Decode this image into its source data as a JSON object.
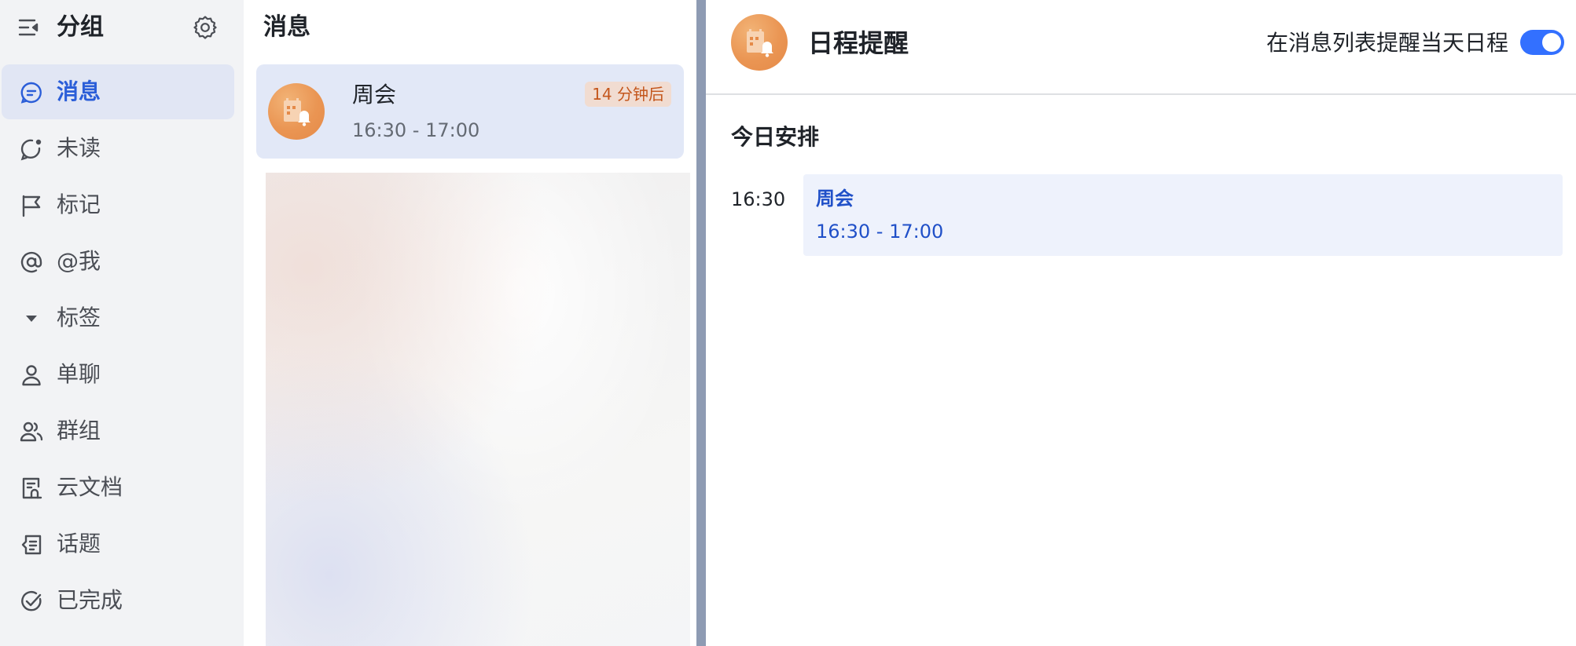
{
  "sidebar": {
    "title": "分组",
    "items": [
      {
        "label": "消息",
        "icon": "chat-bubble-icon",
        "active": true
      },
      {
        "label": "未读",
        "icon": "unread-icon"
      },
      {
        "label": "标记",
        "icon": "flag-icon"
      },
      {
        "label": "@我",
        "icon": "at-icon"
      },
      {
        "label": "标签",
        "icon": "caret-down-icon"
      },
      {
        "label": "单聊",
        "icon": "user-icon"
      },
      {
        "label": "群组",
        "icon": "group-icon"
      },
      {
        "label": "云文档",
        "icon": "document-icon"
      },
      {
        "label": "话题",
        "icon": "topic-icon"
      },
      {
        "label": "已完成",
        "icon": "check-circle-icon"
      }
    ]
  },
  "list": {
    "title": "消息",
    "card": {
      "title": "周会",
      "time": "16:30 - 17:00",
      "badge": "14 分钟后"
    }
  },
  "detail": {
    "title": "日程提醒",
    "toggle_label": "在消息列表提醒当天日程",
    "toggle_on": true,
    "section_title": "今日安排",
    "event": {
      "start": "16:30",
      "title": "周会",
      "range": "16:30 - 17:00"
    }
  },
  "colors": {
    "accent": "#3370ff",
    "active_nav_bg": "#e1e6f4",
    "avatar_orange": "#ea9553",
    "divider": "#8e9bb3"
  }
}
